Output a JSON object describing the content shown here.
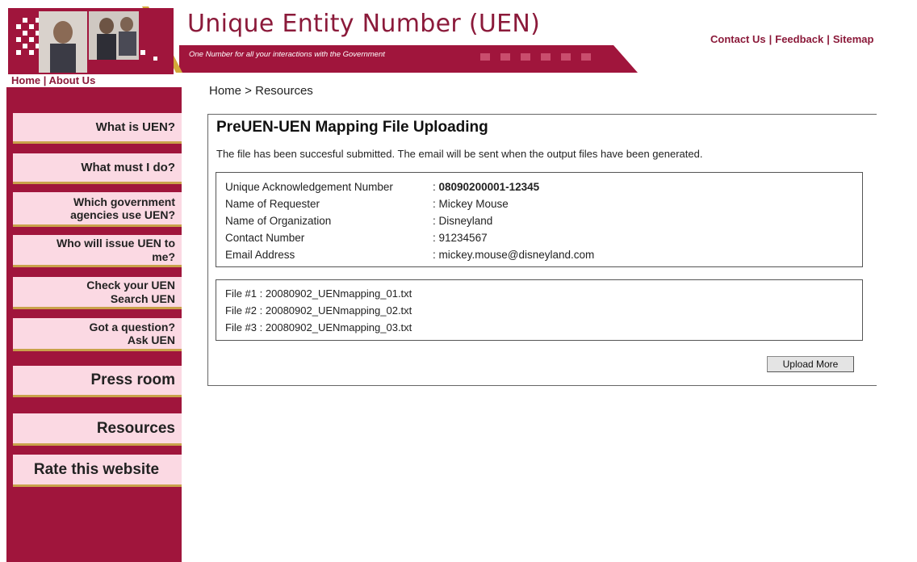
{
  "header": {
    "title": "Unique Entity Number (UEN)",
    "tagline": "One Number for all your interactions with the Government",
    "links": [
      "Contact Us",
      "Feedback",
      "Sitemap"
    ],
    "link_separator": "|",
    "home_link": "Home",
    "about_link": "About Us"
  },
  "colors": {
    "brand": "#a0153c",
    "title": "#8b1a3a",
    "menu_bg": "#fbd9e3",
    "accent_gold": "#c9a24a"
  },
  "sidebar": {
    "items": [
      {
        "line1": "What is UEN?",
        "line2": ""
      },
      {
        "line1": "What must I do?",
        "line2": ""
      },
      {
        "line1": "Which government",
        "line2": "agencies use UEN?"
      },
      {
        "line1": "Who will issue UEN to",
        "line2": "me?"
      },
      {
        "line1": "Check your UEN",
        "line2": "Search UEN"
      },
      {
        "line1": "Got a question?",
        "line2": "Ask UEN"
      },
      {
        "line1": "Press room",
        "line2": ""
      },
      {
        "line1": "Resources",
        "line2": ""
      },
      {
        "line1": "Rate this website",
        "line2": ""
      }
    ]
  },
  "breadcrumb": "Home > Resources",
  "main": {
    "title": "PreUEN-UEN Mapping File Uploading",
    "message": "The file has been succesful submitted. The email will be sent when the output files have been generated.",
    "fields": [
      {
        "label": "Unique Acknowledgement Number",
        "value": "08090200001-12345"
      },
      {
        "label": "Name of Requester",
        "value": "Mickey Mouse"
      },
      {
        "label": "Name of Organization",
        "value": "Disneyland"
      },
      {
        "label": "Contact Number",
        "value": "91234567"
      },
      {
        "label": "Email Address",
        "value": "mickey.mouse@disneyland.com"
      }
    ],
    "files": [
      {
        "label": "File #1",
        "name": "20080902_UENmapping_01.txt"
      },
      {
        "label": "File #2",
        "name": "20080902_UENmapping_02.txt"
      },
      {
        "label": "File #3",
        "name": "20080902_UENmapping_03.txt"
      }
    ],
    "upload_more_label": "Upload More"
  }
}
